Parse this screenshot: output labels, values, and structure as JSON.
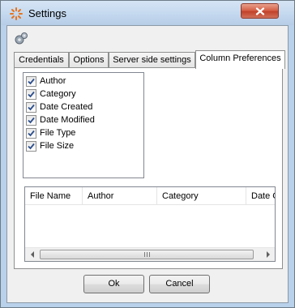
{
  "window": {
    "title": "Settings",
    "icons": [
      "app-icon",
      "close-icon",
      "gear-icon"
    ]
  },
  "tabs": [
    {
      "label": "Credentials",
      "active": false
    },
    {
      "label": "Options",
      "active": false
    },
    {
      "label": "Server side settings",
      "active": false
    },
    {
      "label": "Column Preferences",
      "active": true
    }
  ],
  "columns_checklist": [
    {
      "label": "Author",
      "checked": true
    },
    {
      "label": "Category",
      "checked": true
    },
    {
      "label": "Date Created",
      "checked": true
    },
    {
      "label": "Date Modified",
      "checked": true
    },
    {
      "label": "File Type",
      "checked": true
    },
    {
      "label": "File Size",
      "checked": true
    }
  ],
  "listview": {
    "headers": [
      "File Name",
      "Author",
      "Category",
      "Date Created"
    ],
    "rows": []
  },
  "buttons": {
    "ok": "Ok",
    "cancel": "Cancel"
  },
  "colors": {
    "titlebar": "#c2d7ee",
    "close_button": "#c2422a",
    "dialog_background": "#f0f0f0",
    "checkmark": "#2b4e8c"
  }
}
